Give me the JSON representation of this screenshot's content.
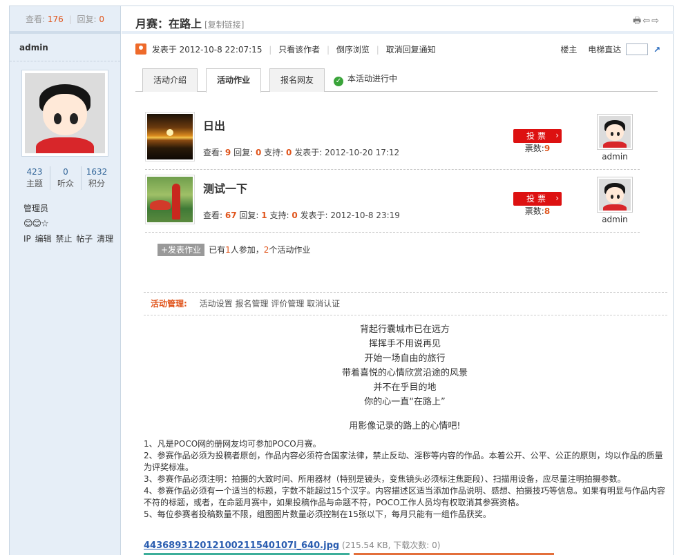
{
  "sidebar": {
    "views_label": "查看:",
    "views": "176",
    "replies_label": "回复:",
    "replies": "0",
    "author": "admin",
    "stats": [
      {
        "value": "423",
        "label": "主题"
      },
      {
        "value": "0",
        "label": "听众"
      },
      {
        "value": "1632",
        "label": "积分"
      }
    ],
    "role": "管理员",
    "medals": "😊😊☆",
    "ops": [
      "IP",
      "编辑",
      "禁止",
      "帖子",
      "清理"
    ]
  },
  "header": {
    "title": "月赛：在路上",
    "copy_link": "[复制链接]",
    "tools": "🖶⇦⇨"
  },
  "post": {
    "posted": "发表于 2012-10-8 22:07:15",
    "author_only": "只看该作者",
    "reverse": "倒序浏览",
    "cancel_notify": "取消回复通知",
    "floor_owner": "楼主",
    "elevator": "电梯直达"
  },
  "tabs": {
    "intro": "活动介绍",
    "works": "活动作业",
    "signup": "报名网友",
    "status": "本活动进行中"
  },
  "works": [
    {
      "title": "日出",
      "views": "9",
      "replies": "0",
      "support": "0",
      "date": "发表于: 2012-10-20 17:12",
      "vote_label": "投票",
      "votes_label": "票数:",
      "votes": "9",
      "user": "admin"
    },
    {
      "title": "测试一下",
      "views": "67",
      "replies": "1",
      "support": "0",
      "date": "发表于: 2012-10-8 23:19",
      "vote_label": "投票",
      "votes_label": "票数:",
      "votes": "8",
      "user": "admin"
    }
  ],
  "meta_labels": {
    "views": "查看:",
    "replies": "回复:",
    "support": "支持:"
  },
  "add": {
    "button": "+发表作业",
    "pre": "已有",
    "people": "1",
    "mid": "人参加，",
    "works": "2",
    "post": "个活动作业"
  },
  "manage": {
    "label": "活动管理:",
    "items": [
      "活动设置",
      "报名管理",
      "评价管理",
      "取消认证"
    ]
  },
  "poem": [
    "背起行囊城市已在远方",
    "挥挥手不用说再见",
    "开始一场自由的旅行",
    "带着喜悦的心情欣赏沿途的风景",
    "并不在乎目的地",
    "你的心一直“在路上”"
  ],
  "slogan": "用影像记录的路上的心情吧!",
  "rules": [
    "1、凡是POCO网的册网友均可参加POCO月赛。",
    "2、参赛作品必须为投稿者原创，作品内容必须符合国家法律，禁止反动、淫秽等内容的作品。本着公开、公平、公正的原则，均以作品的质量为评奖标准。",
    "3、参赛作品必须注明：拍摄的大致时间、所用器材（特别是镜头，变焦镜头必须标注焦距段）、扫描用设备，应尽量注明拍摄参数。",
    "4、参赛作品必须有一个适当的标题，字数不能超过15个汉字。内容描述区适当添加作品说明、感想、拍摄技巧等信息。如果有明显与作品内容不符的标题，或者，在命题月赛中，如果投稿作品与命题不符，POCO工作人员均有权取消其参赛资格。",
    "5、每位参赛者投稿数量不限，组图图片数量必须控制在15张以下，每月只能有一组作品获奖。"
  ],
  "attachment": {
    "name": "443689312012100211540107l_640.jpg",
    "info": "(215.54 KB, 下载次数: 0)"
  },
  "colors": {
    "accent": "#e0541b",
    "vote": "#dd1111",
    "link": "#336699",
    "sidebar_bg": "#e6eef7"
  }
}
